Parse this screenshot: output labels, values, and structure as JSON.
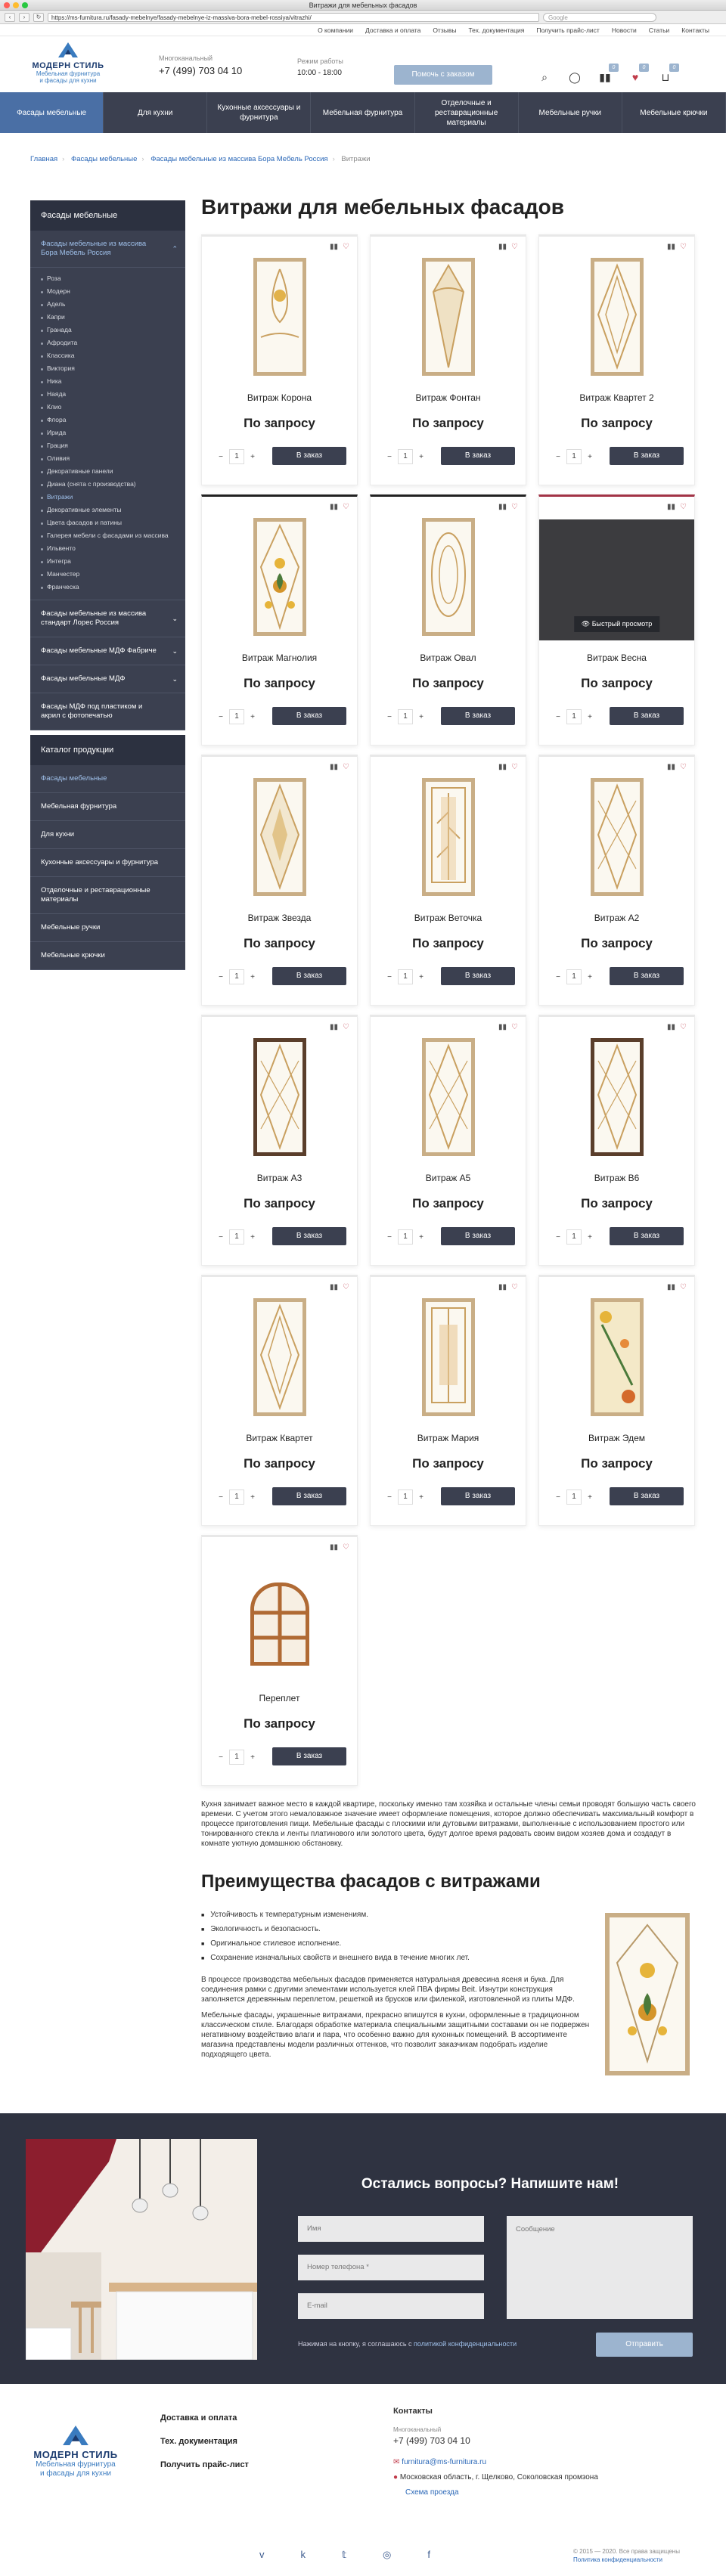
{
  "browser": {
    "window_title": "Витражи для мебельных фасадов",
    "url": "https://ms-furnitura.ru/fasady-mebelnye/fasady-mebelnye-iz-massiva-bora-mebel-rossiya/vitrazhi/",
    "search_placeholder": "Google",
    "back": "‹",
    "forward": "›",
    "reload": "↻"
  },
  "topnav": [
    "О компании",
    "Доставка и оплата",
    "Отзывы",
    "Тех. документация",
    "Получить прайс-лист",
    "Новости",
    "Статьи",
    "Контакты"
  ],
  "logo": {
    "name": "МОДЕРН СТИЛЬ",
    "tagline_1": "Мебельная фурнитура",
    "tagline_2": "и фасады для кухни"
  },
  "header": {
    "phone_label": "Многоканальный",
    "phone": "+7 (499) 703 04 10",
    "hours_label": "Режим работы",
    "hours": "10:00 - 18:00",
    "help_button": "Помочь с заказом",
    "compare_count": "0",
    "wish_count": "0",
    "cart_count": "0"
  },
  "mainnav": [
    "Фасады мебельные",
    "Для кухни",
    "Кухонные аксессуары и фурнитура",
    "Мебельная фурнитура",
    "Отделочные и реставрационные материалы",
    "Мебельные ручки",
    "Мебельные крючки"
  ],
  "breadcrumbs": [
    "Главная",
    "Фасады мебельные",
    "Фасады мебельные из массива Бора Мебель Россия",
    "Витражи"
  ],
  "sidebar": {
    "title": "Фасады мебельные",
    "section_active": "Фасады мебельные из массива Бора Мебель Россия",
    "sub": [
      "Роза",
      "Модерн",
      "Адель",
      "Капри",
      "Гранада",
      "Афродита",
      "Классика",
      "Виктория",
      "Ника",
      "Наяда",
      "Клио",
      "Флора",
      "Ирида",
      "Грация",
      "Оливия",
      "Декоративные панели",
      "Диана (снята с производства)",
      "Витражи",
      "Декоративные элементы",
      "Цвета фасадов и патины",
      "Галерея мебели с фасадами из массива",
      "Ильвенто",
      "Интегра",
      "Манчестер",
      "Франческа"
    ],
    "sections": [
      "Фасады мебельные из массива стандарт Лорес Россия",
      "Фасады мебельные МДФ Фабриче",
      "Фасады мебельные МДФ",
      "Фасады МДФ под пластиком и акрил с фотопечатью"
    ],
    "catalog_title": "Каталог продукции",
    "catalog": [
      "Фасады мебельные",
      "Мебельная фурнитура",
      "Для кухни",
      "Кухонные аксессуары и фурнитура",
      "Отделочные и реставрационные материалы",
      "Мебельные ручки",
      "Мебельные крючки"
    ]
  },
  "page_title": "Витражи для мебельных фасадов",
  "card_labels": {
    "price": "По запросу",
    "button": "В заказ",
    "quantity": "1",
    "minus": "−",
    "plus": "+",
    "quick_view": "Быстрый просмотр"
  },
  "products": [
    {
      "name": "Витраж Корона"
    },
    {
      "name": "Витраж Фонтан"
    },
    {
      "name": "Витраж Квартет 2"
    },
    {
      "name": "Витраж Магнолия"
    },
    {
      "name": "Витраж Овал"
    },
    {
      "name": "Витраж Весна"
    },
    {
      "name": "Витраж Звезда"
    },
    {
      "name": "Витраж Веточка"
    },
    {
      "name": "Витраж А2"
    },
    {
      "name": "Витраж А3"
    },
    {
      "name": "Витраж А5"
    },
    {
      "name": "Витраж В6"
    },
    {
      "name": "Витраж Квартет"
    },
    {
      "name": "Витраж Мария"
    },
    {
      "name": "Витраж Эдем"
    },
    {
      "name": "Переплет"
    }
  ],
  "description": "Кухня занимает важное место в каждой квартире, поскольку именно там хозяйка и остальные члены семьи проводят большую часть своего времени. С учетом этого немаловажное значение имеет оформление помещения, которое должно обеспечивать максимальный комфорт в процессе приготовления пищи. Мебельные фасады с плоскими или дутовыми витражами, выполненные с использованием простого или тонированного стекла и ленты платинового или золотого цвета, будут долгое время радовать своим видом хозяев дома и создадут в комнате уютную домашнюю обстановку.",
  "advantages": {
    "title": "Преимущества фасадов с витражами",
    "list": [
      "Устойчивость к температурным изменениям.",
      "Экологичность и безопасность.",
      "Оригинальное стилевое исполнение.",
      "Сохранение изначальных свойств и внешнего вида в течение многих лет."
    ],
    "p1": "В процессе производства мебельных фасадов применяется натуральная древесина ясеня и бука. Для соединения рамки с другими элементами используется клей ПВА фирмы Beit. Изнутри конструкция заполняется деревянным переплетом, решеткой из брусков или филенкой, изготовленной из плиты МДФ.",
    "p2": "Мебельные фасады, украшенные витражами, прекрасно впишутся в кухни, оформленные в традиционном классическом стиле. Благодаря обработке материала специальными защитными составами он не подвержен негативному воздействию влаги и пара, что особенно важно для кухонных помещений. В ассортименте магазина представлены модели различных оттенков, что позволит заказчикам подобрать изделие подходящего цвета."
  },
  "contact_form": {
    "title": "Остались вопросы? Напишите нам!",
    "name": "Имя",
    "phone": "Номер телефона *",
    "email": "E-mail",
    "message": "Сообщение",
    "agree_text": "Нажимая на кнопку, я соглашаюсь с",
    "agree_link": "политикой конфиденциальности",
    "submit": "Отправить"
  },
  "footer": {
    "links": [
      "Доставка и оплата",
      "Тех. документация",
      "Получить прайс-лист"
    ],
    "contacts_title": "Контакты",
    "phone_label": "Многоканальный",
    "phone": "+7 (499) 703 04 10",
    "email": "furnitura@ms-furnitura.ru",
    "address": "Московская область, г. Щелково, Соколовская промзона",
    "map_link": "Схема проезда",
    "social": [
      "vk",
      "twitter",
      "instagram",
      "facebook"
    ],
    "copyright": "© 2015 — 2020. Все права защищены",
    "policy": "Политика конфиденциальности"
  },
  "colors": {
    "nav": "#3b4050",
    "accent": "#9cb4cf",
    "link": "#2a67b7",
    "heart": "#c03b4a"
  }
}
